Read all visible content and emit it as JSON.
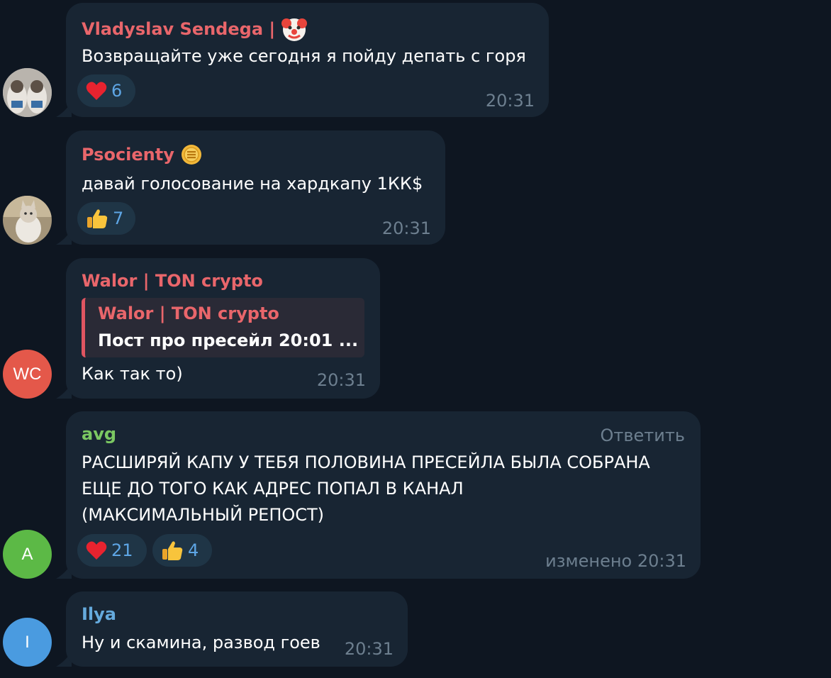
{
  "colors": {
    "background": "#0e1621",
    "bubble": "#182533",
    "reaction_bg": "#1f3546",
    "reaction_count": "#5ea6e5",
    "time": "#6d7f8f",
    "name_red": "#e9666b",
    "name_green": "#7bc862",
    "name_blue": "#65aadd"
  },
  "messages": [
    {
      "sender": "Vladyslav Sendega |",
      "sender_emoji": "clown-face-icon",
      "text": "Возвращайте уже сегодня я пойду депать с горя",
      "reactions": [
        {
          "emoji": "heart-icon",
          "count": "6"
        }
      ],
      "time": "20:31"
    },
    {
      "sender": "Psocienty",
      "sender_emoji": "gold-coin-icon",
      "text": "давай голосование на хардкапу 1КК$",
      "reactions": [
        {
          "emoji": "thumbs-up-icon",
          "count": "7"
        }
      ],
      "time": "20:31"
    },
    {
      "sender": "Walor | TON crypto",
      "avatar_initials": "WC",
      "reply_to": {
        "sender": "Walor | TON crypto",
        "text": "Пост про пресейл 20:01 ..."
      },
      "text": "Как так то)",
      "time": "20:31"
    },
    {
      "sender": "avg",
      "avatar_initials": "A",
      "action": "Ответить",
      "text_lines": [
        "РАСШИРЯЙ КАПУ У ТЕБЯ ПОЛОВИНА ПРЕСЕЙЛА БЫЛА СОБРАНА",
        "ЕЩЕ ДО ТОГО КАК АДРЕС ПОПАЛ В КАНАЛ",
        "(МАКСИМАЛЬНЫЙ РЕПОСТ)"
      ],
      "reactions": [
        {
          "emoji": "heart-icon",
          "count": "21"
        },
        {
          "emoji": "thumbs-up-icon",
          "count": "4"
        }
      ],
      "time": "изменено 20:31"
    },
    {
      "sender": "Ilya",
      "avatar_initials": "I",
      "text": "Ну и скамина, развод гоев",
      "time": "20:31"
    }
  ]
}
